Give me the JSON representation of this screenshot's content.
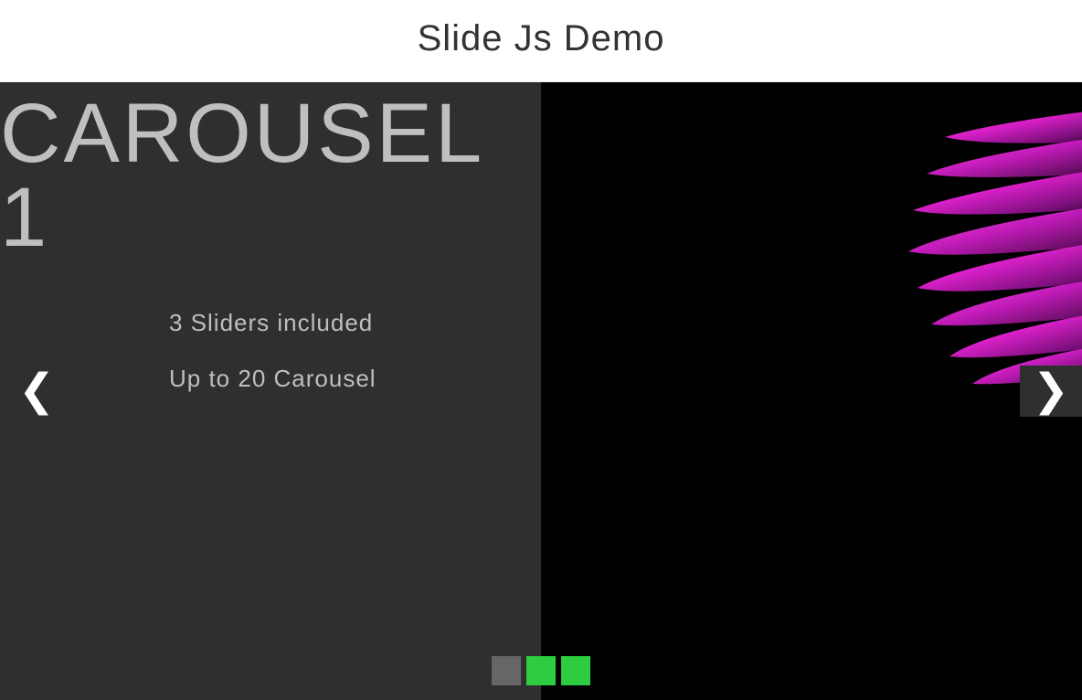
{
  "header": {
    "title": "Slide Js Demo"
  },
  "carousel": {
    "current_slide": {
      "title": "CAROUSEL 1",
      "features": [
        "3 Sliders included",
        "Up to 20 Carousel"
      ]
    },
    "nav": {
      "prev_glyph": "❮",
      "next_glyph": "❯"
    },
    "indicators": {
      "count": 3,
      "active_index": 0,
      "active_color": "#666666",
      "inactive_color": "#2ecc40"
    }
  }
}
